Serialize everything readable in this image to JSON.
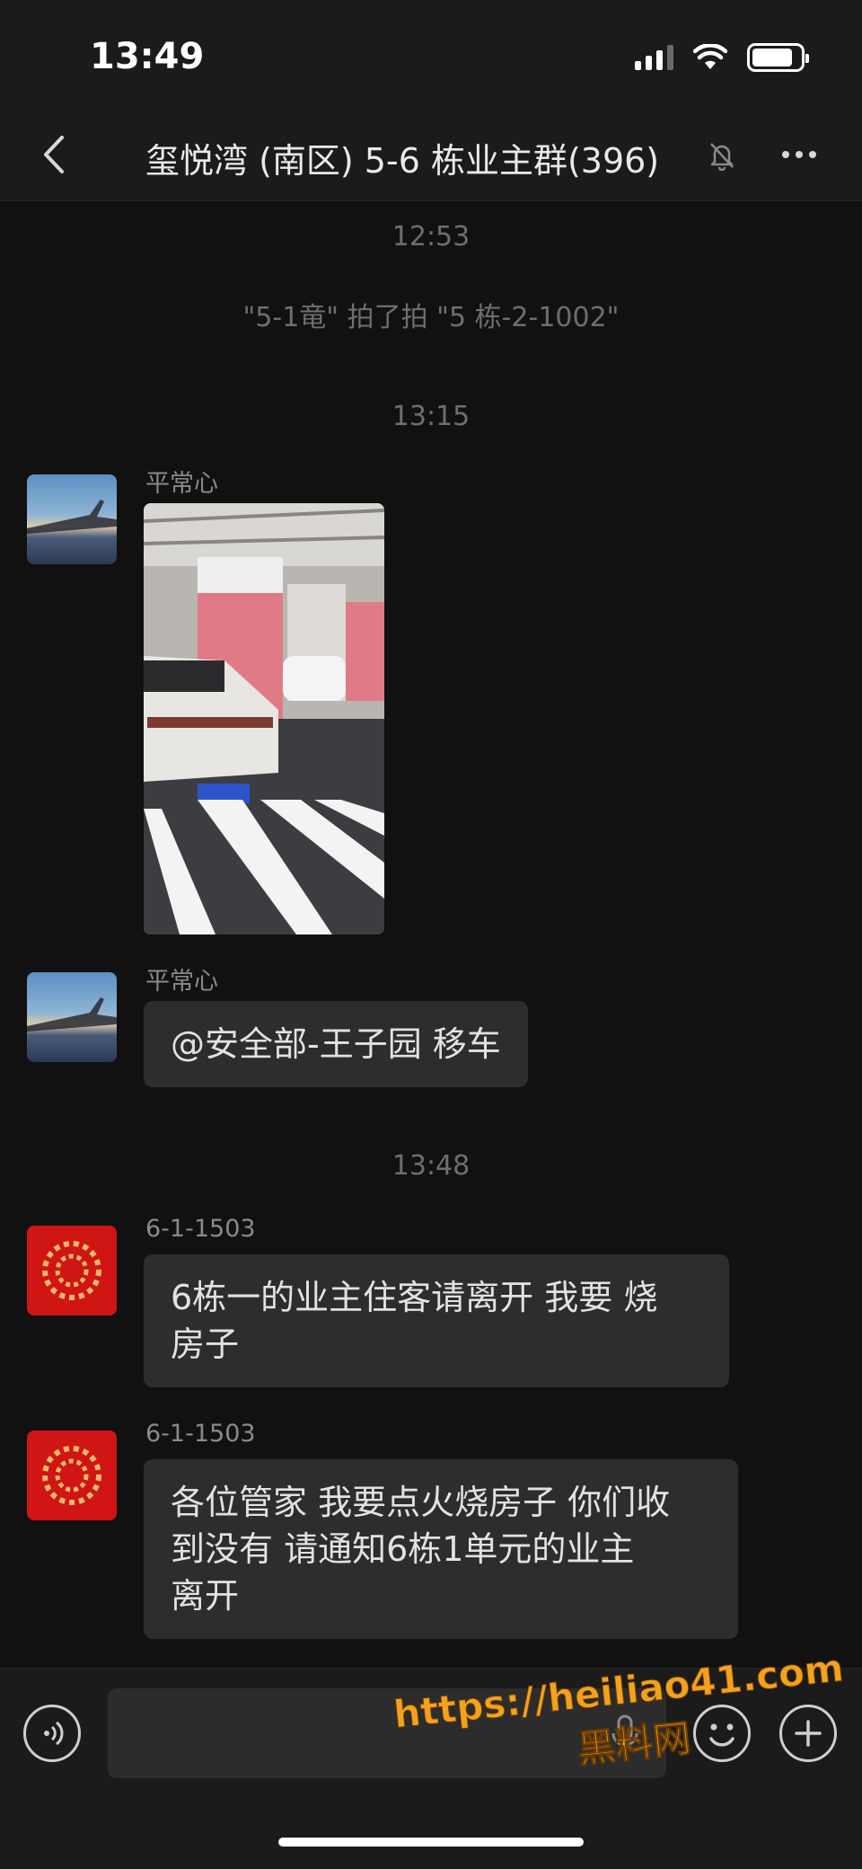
{
  "status_bar": {
    "time": "13:49"
  },
  "nav": {
    "title": "玺悦湾 (南区) 5-6 栋业主群(396)"
  },
  "chat": {
    "time_1": "12:53",
    "system_pat": "\"5-1竜\" 拍了拍 \"5 栋-2-1002\"",
    "time_2": "13:15",
    "msg_photo": {
      "sender": "平常心"
    },
    "msg_text_1": {
      "sender": "平常心",
      "text": "@安全部-王子园 移车"
    },
    "time_3": "13:48",
    "msg_text_2": {
      "sender": "6-1-1503",
      "line1": "6栋一的业主住客请离开 我要 烧",
      "line2": "房子"
    },
    "msg_text_3": {
      "sender": "6-1-1503",
      "line1": "各位管家 我要点火烧房子 你们收",
      "line2": "到没有 请通知6栋1单元的业主",
      "line3": "离开"
    }
  },
  "input_bar": {
    "value": ""
  },
  "watermark": {
    "url": "https://heiliao41.com",
    "name": "黑料网"
  },
  "colors": {
    "background": "#111111",
    "bubble": "#2d2d2d",
    "bar": "#1b1b1b",
    "watermark": "#f3a21e"
  },
  "icons": [
    "back-icon",
    "mute-bell-icon",
    "more-icon",
    "voice-icon",
    "mic-icon",
    "emoji-icon",
    "plus-icon"
  ]
}
